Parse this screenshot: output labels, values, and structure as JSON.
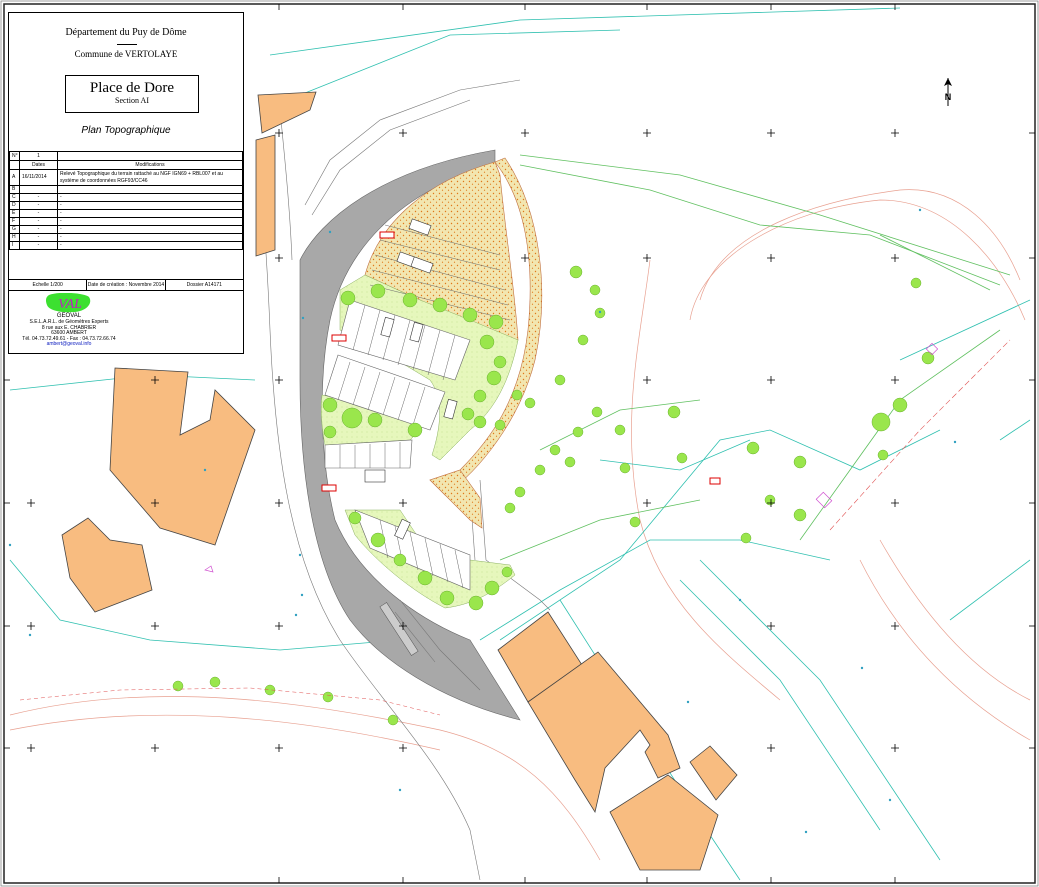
{
  "cartouche": {
    "departement": "Département du Puy de Dôme",
    "commune": "Commune de VERTOLAYE",
    "title": "Place de Dore",
    "section": "Section AI",
    "plan_type": "Plan Topographique",
    "numero_label": "N°",
    "numero_value": "1",
    "col_dates": "Dates",
    "col_modifications": "Modifications",
    "rows": [
      {
        "letter": "A",
        "date": "16/11/2014",
        "text": "Relevé Topographique du terrain rattaché au NGF IGN69 + RBL007 et au système de coordonnées RGF93/CC46"
      },
      {
        "letter": "B",
        "date": "",
        "text": ""
      },
      {
        "letter": "C",
        "date": "-",
        "text": "-"
      },
      {
        "letter": "D",
        "date": "-",
        "text": "-"
      },
      {
        "letter": "E",
        "date": "-",
        "text": "-"
      },
      {
        "letter": "F",
        "date": "-",
        "text": "-"
      },
      {
        "letter": "G",
        "date": "-",
        "text": "-"
      },
      {
        "letter": "H",
        "date": "-",
        "text": "-"
      },
      {
        "letter": "I",
        "date": "-",
        "text": "-"
      }
    ],
    "echelle": "Echelle 1/200",
    "date_creation": "Date de création : Novembre 2014",
    "dossier": "Dossier A14171",
    "logo_text": "VAL",
    "firm": {
      "name": "GEOVAL",
      "line1": "S.E.L.A.R.L. de Géomètres Experts",
      "line2": "8 rue aux E. CHABRIER",
      "line3": "63600 AMBERT",
      "phone": "Tél. 04.73.72.49.61 - Fax : 04.73.72.66.74",
      "email": "ambert@geoval.info"
    }
  },
  "map": {
    "north_label": "N",
    "colors": {
      "building": "#f8bc80",
      "road": "#a8a8a8",
      "gravel": "#f2e6b0",
      "gravel_dots": "#e07818",
      "grass": "#e6f7bc",
      "tree": "#9ae64c",
      "parcel_line": "#30c0b0",
      "contour_line": "#e8a090",
      "green_line": "#60c060"
    }
  }
}
